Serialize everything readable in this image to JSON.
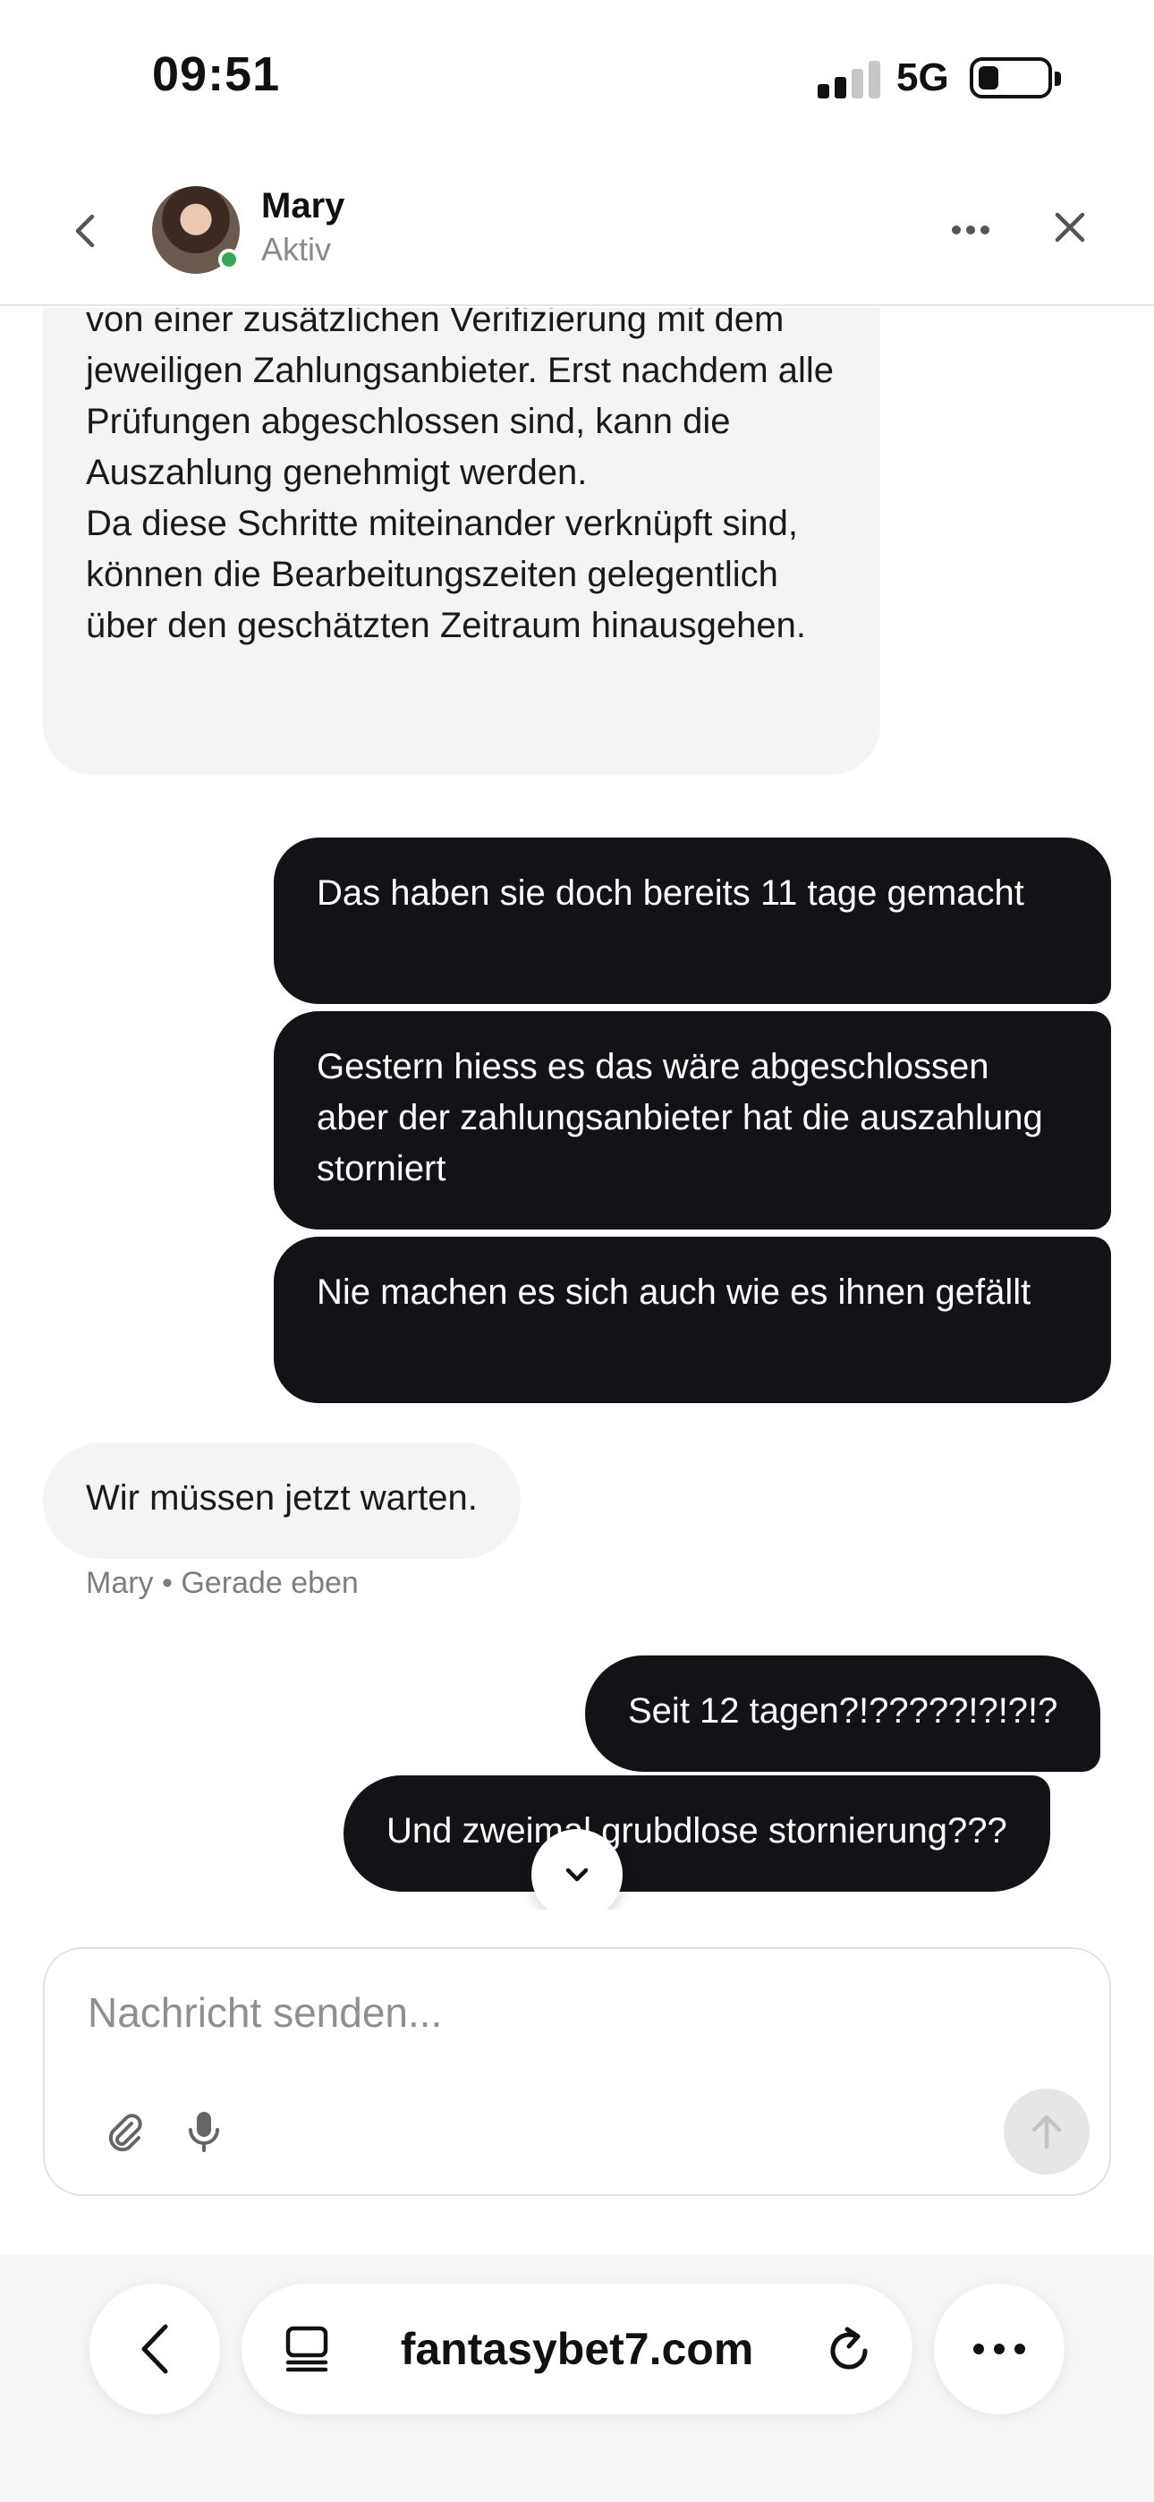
{
  "status_bar": {
    "time": "09:51",
    "network": "5G",
    "battery_level": 0.2,
    "signal_bars_active": 2,
    "signal_bars_total": 4
  },
  "header": {
    "contact_name": "Mary",
    "contact_status": "Aktiv",
    "online_color": "#34a853"
  },
  "messages": {
    "agent_long": {
      "lines": [
        "von einer zusätzlichen Verifizierung mit dem jeweiligen Zahlungsanbieter. Erst nachdem alle Prüfungen abgeschlossen sind, kann die Auszahlung genehmigt werden.",
        "Da diese Schritte miteinander verknüpft sind, können die Bearbeitungszeiten gelegentlich über den geschätzten Zeitraum hinausgehen."
      ]
    },
    "user_1": "Das haben sie doch bereits 11 tage gemacht",
    "user_2": "Gestern hiess es das wäre abgeschlossen aber der zahlungsanbieter hat die auszahlung storniert",
    "user_3": "Nie machen es sich auch wie es ihnen gefällt",
    "agent_short": "Wir müssen jetzt warten.",
    "agent_meta": "Mary • Gerade eben",
    "user_4": "Seit 12 tagen?!?????!?!?!?",
    "user_5": "Und zweimal grubdlose stornierung???"
  },
  "composer": {
    "placeholder": "Nachricht senden..."
  },
  "browser": {
    "address": "fantasybet7.com"
  },
  "icons": {
    "back": "chevron-left-icon",
    "more": "ellipsis-icon",
    "close": "close-icon",
    "scroll_down": "chevron-down-icon",
    "attach": "paperclip-icon",
    "mic": "microphone-icon",
    "send": "arrow-up-icon",
    "tabs": "tabs-icon",
    "reload": "reload-icon"
  },
  "colors": {
    "user_bubble": "#131217",
    "agent_bubble": "#f4f4f4",
    "send_button_disabled": "#e6e6e6"
  }
}
